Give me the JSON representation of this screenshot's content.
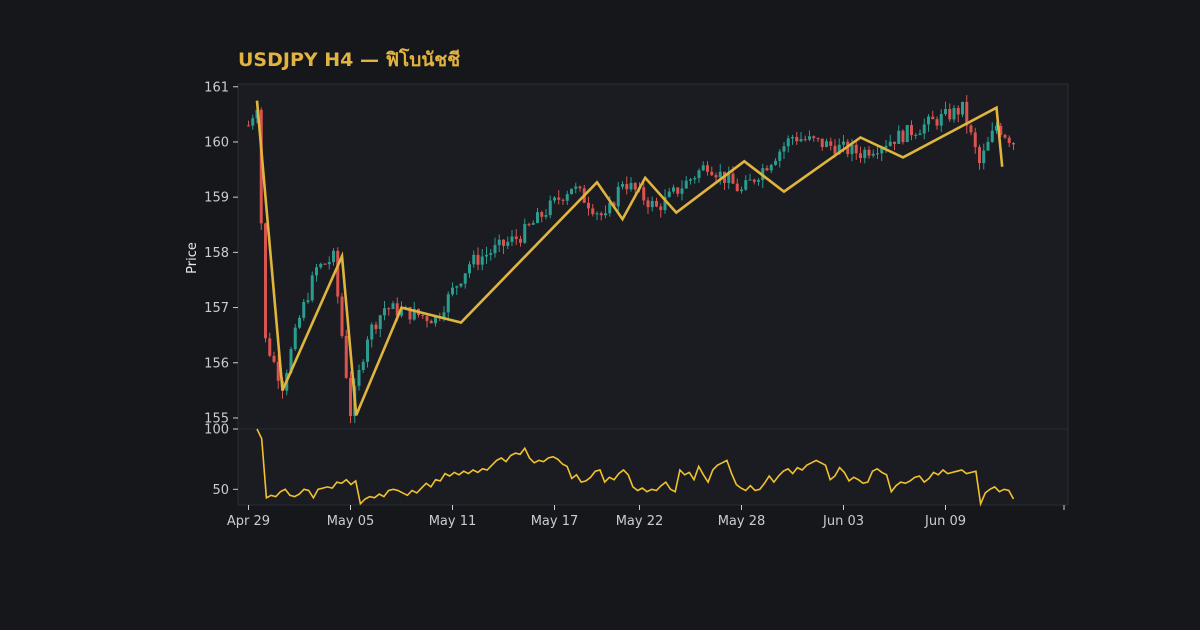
{
  "title": "USDJPY H4 — ฟิโบนัชชี",
  "colors": {
    "background": "#16171b",
    "panel": "#1a1c22",
    "up_candle": "#2a9d8f",
    "down_candle": "#d9534f",
    "zigzag": "#e0b53e",
    "oscillator": "#f2c12e",
    "title": "#e3b341",
    "axis_text": "#c9ccd2"
  },
  "chart_data": [
    {
      "type": "candlestick",
      "ylabel": "Price",
      "ylim": [
        154.8,
        161.05
      ],
      "yticks": [
        155,
        156,
        157,
        158,
        159,
        160,
        161
      ],
      "x_start": "2024-04-29",
      "x_end": "2024-06-13",
      "xticks": [
        "Apr 29",
        "May 05",
        "May 11",
        "May 17",
        "May 22",
        "May 28",
        "Jun 03",
        "Jun 09"
      ],
      "xtick_dates": [
        "2024-04-29",
        "2024-05-05",
        "2024-05-11",
        "2024-05-17",
        "2024-05-22",
        "2024-05-28",
        "2024-06-03",
        "2024-06-09"
      ],
      "grid": false,
      "candles_anchor_closes": [
        {
          "date": "2024-04-29",
          "close": 160.3
        },
        {
          "date": "2024-04-29T12:00",
          "close": 160.7
        },
        {
          "date": "2024-04-30",
          "close": 156.4
        },
        {
          "date": "2024-05-01",
          "close": 155.6
        },
        {
          "date": "2024-05-02",
          "close": 156.8
        },
        {
          "date": "2024-05-03",
          "close": 157.7
        },
        {
          "date": "2024-05-04",
          "close": 157.9
        },
        {
          "date": "2024-05-05",
          "close": 155.1
        },
        {
          "date": "2024-05-06",
          "close": 156.5
        },
        {
          "date": "2024-05-07",
          "close": 157.0
        },
        {
          "date": "2024-05-10",
          "close": 156.8
        },
        {
          "date": "2024-05-12",
          "close": 157.8
        },
        {
          "date": "2024-05-15",
          "close": 158.3
        },
        {
          "date": "2024-05-18",
          "close": 159.2
        },
        {
          "date": "2024-05-20",
          "close": 158.6
        },
        {
          "date": "2024-05-21",
          "close": 159.3
        },
        {
          "date": "2024-05-23",
          "close": 158.8
        },
        {
          "date": "2024-05-26",
          "close": 159.6
        },
        {
          "date": "2024-05-28",
          "close": 159.1
        },
        {
          "date": "2024-05-31",
          "close": 160.1
        },
        {
          "date": "2024-06-04",
          "close": 159.8
        },
        {
          "date": "2024-06-10",
          "close": 160.6
        },
        {
          "date": "2024-06-11",
          "close": 159.6
        },
        {
          "date": "2024-06-12",
          "close": 160.3
        },
        {
          "date": "2024-06-13",
          "close": 160.0
        }
      ],
      "zigzag": [
        {
          "date": "2024-04-29T12:00",
          "price": 160.75
        },
        {
          "date": "2024-05-01",
          "price": 155.5
        },
        {
          "date": "2024-05-04T12:00",
          "price": 157.93
        },
        {
          "date": "2024-05-05T08:00",
          "price": 155.05
        },
        {
          "date": "2024-05-08",
          "price": 157.0
        },
        {
          "date": "2024-05-11T12:00",
          "price": 156.73
        },
        {
          "date": "2024-05-19T12:00",
          "price": 159.27
        },
        {
          "date": "2024-05-21",
          "price": 158.6
        },
        {
          "date": "2024-05-22T08:00",
          "price": 159.35
        },
        {
          "date": "2024-05-24T04:00",
          "price": 158.72
        },
        {
          "date": "2024-05-28T04:00",
          "price": 159.65
        },
        {
          "date": "2024-05-30T12:00",
          "price": 159.1
        },
        {
          "date": "2024-06-04",
          "price": 160.08
        },
        {
          "date": "2024-06-06T12:00",
          "price": 159.72
        },
        {
          "date": "2024-06-12",
          "price": 160.62
        },
        {
          "date": "2024-06-12T08:00",
          "price": 159.55
        }
      ]
    },
    {
      "type": "line",
      "ylim": [
        37,
        100
      ],
      "yticks": [
        50,
        100
      ],
      "values": [
        100,
        92,
        43,
        45,
        44,
        48,
        50,
        45,
        44,
        46,
        50,
        49,
        43,
        50,
        51,
        52,
        51,
        56,
        55,
        58,
        54,
        57,
        38,
        42,
        44,
        43,
        46,
        44,
        49,
        50,
        49,
        47,
        45,
        49,
        47,
        51,
        55,
        52,
        58,
        57,
        63,
        61,
        64,
        62,
        65,
        63,
        66,
        64,
        67,
        66,
        70,
        74,
        76,
        73,
        78,
        80,
        79,
        84,
        76,
        72,
        74,
        73,
        76,
        77,
        75,
        71,
        69,
        59,
        62,
        56,
        57,
        60,
        65,
        66,
        56,
        60,
        58,
        63,
        66,
        62,
        52,
        49,
        51,
        48,
        50,
        49,
        53,
        56,
        50,
        48,
        66,
        62,
        64,
        58,
        69,
        62,
        56,
        66,
        70,
        72,
        74,
        63,
        54,
        51,
        49,
        53,
        49,
        50,
        55,
        61,
        56,
        61,
        65,
        67,
        63,
        68,
        66,
        70,
        72,
        74,
        72,
        70,
        58,
        61,
        68,
        64,
        57,
        60,
        58,
        55,
        56,
        65,
        67,
        64,
        62,
        48,
        53,
        56,
        55,
        57,
        60,
        61,
        56,
        59,
        64,
        62,
        66,
        63,
        64,
        65,
        66,
        63,
        64,
        65,
        38,
        47,
        50,
        52,
        48,
        50,
        49,
        42
      ]
    }
  ]
}
